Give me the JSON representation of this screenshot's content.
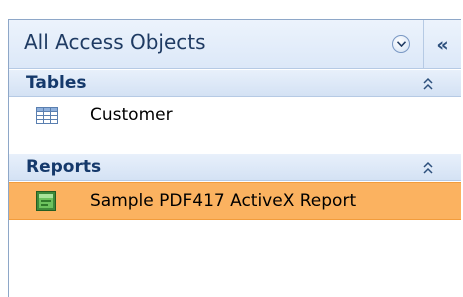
{
  "nav_pane": {
    "title": "All Access Objects",
    "groups": [
      {
        "label": "Tables",
        "items": [
          {
            "label": "Customer",
            "icon": "table-icon",
            "selected": false
          }
        ]
      },
      {
        "label": "Reports",
        "items": [
          {
            "label": "Sample PDF417 ActiveX Report",
            "icon": "report-icon",
            "selected": true
          }
        ]
      }
    ],
    "colors": {
      "header_text": "#1f3b63",
      "group_text": "#15396b",
      "selection": "#fbb260"
    }
  }
}
